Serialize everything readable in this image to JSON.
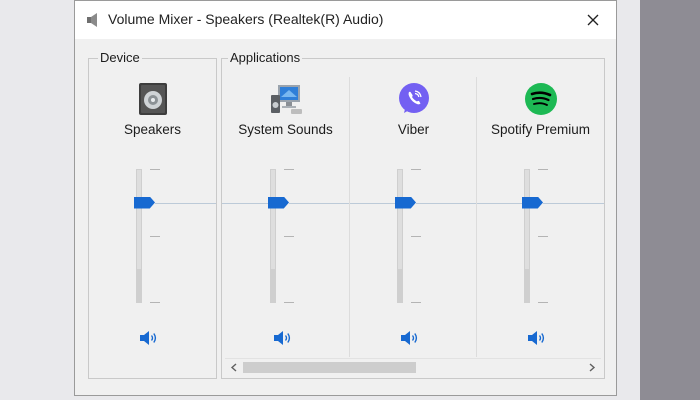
{
  "window": {
    "title": "Volume Mixer - Speakers (Realtek(R) Audio)",
    "close_glyph": "✕"
  },
  "device": {
    "label": "Device",
    "name": "Speakers",
    "icon": "speaker-device-icon",
    "level": 0.75
  },
  "applications": {
    "label": "Applications",
    "items": [
      {
        "name": "System Sounds",
        "icon": "system-sounds-icon",
        "level": 0.75
      },
      {
        "name": "Viber",
        "icon": "viber-icon",
        "level": 0.75,
        "color": "#7360f2"
      },
      {
        "name": "Spotify Premium",
        "icon": "spotify-icon",
        "level": 0.75,
        "color": "#1db954"
      }
    ]
  },
  "colors": {
    "accent": "#1769d1"
  }
}
